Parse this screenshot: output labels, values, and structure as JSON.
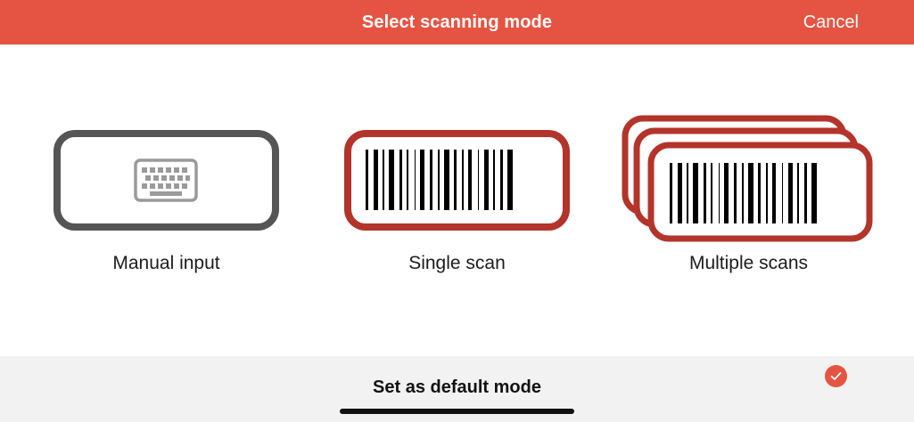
{
  "header": {
    "title": "Select scanning mode",
    "cancel_label": "Cancel"
  },
  "modes": [
    {
      "label": "Manual input",
      "icon": "keyboard-icon",
      "frame_color": "#555555"
    },
    {
      "label": "Single scan",
      "icon": "barcode-icon",
      "frame_color": "#b3342a"
    },
    {
      "label": "Multiple scans",
      "icon": "barcode-stack-icon",
      "frame_color": "#b3342a"
    }
  ],
  "footer": {
    "default_label": "Set as default mode",
    "default_checked": true,
    "accent": "#e55442"
  },
  "colors": {
    "header_bg": "#e55442",
    "scan_frame": "#b3342a",
    "manual_frame": "#555555"
  }
}
